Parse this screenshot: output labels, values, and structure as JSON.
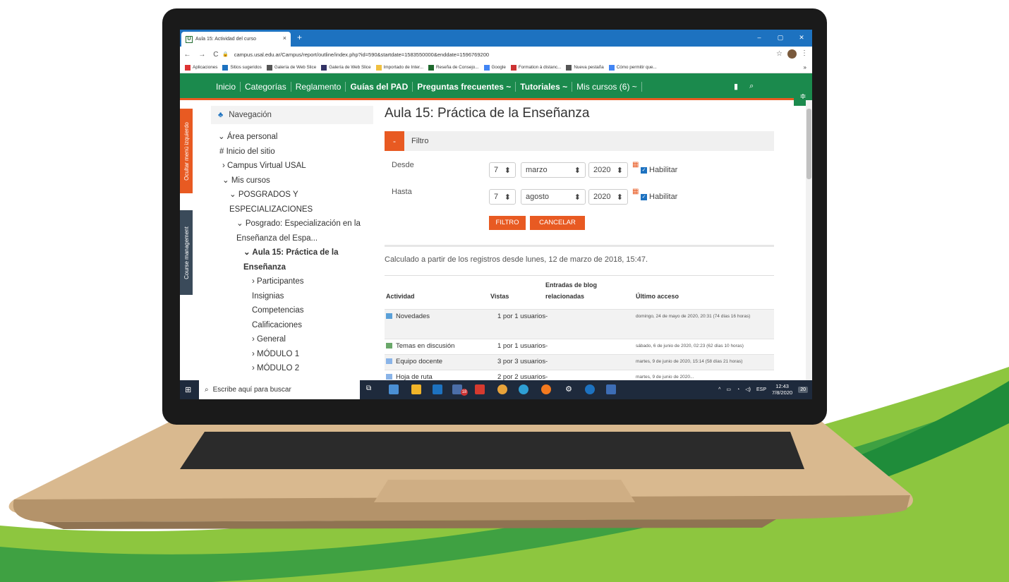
{
  "colors": {
    "site_green": "#1b8a4d",
    "accent_orange": "#e85a22",
    "browser_blue": "#1d72c0",
    "swoosh_light": "#8dc63f",
    "swoosh_dark": "#1f8c3a"
  },
  "browser": {
    "tab_title": "Aula 15: Actividad del curso",
    "tab_favicon": "U",
    "url": "campus.usal.edu.ar/Campus/report/outline/index.php?id=590&startdate=1583550000&enddate=1596769200",
    "bookmarks": [
      {
        "label": "Aplicaciones",
        "icon": "apps-icon"
      },
      {
        "label": "Sitios sugeridos",
        "icon": "bing-icon"
      },
      {
        "label": "Galería de Web Slice",
        "icon": "globe-icon"
      },
      {
        "label": "Galería de Web Slice",
        "icon": "slice-icon"
      },
      {
        "label": "Importado de Inter...",
        "icon": "folder-icon"
      },
      {
        "label": "Reseña de Consejo...",
        "icon": "usal-icon"
      },
      {
        "label": "Google",
        "icon": "google-icon"
      },
      {
        "label": "Formation à distanc...",
        "icon": "formation-icon"
      },
      {
        "label": "Nueva pestaña",
        "icon": "globe-icon"
      },
      {
        "label": "Cómo permitir que...",
        "icon": "google-icon"
      }
    ]
  },
  "site_nav": {
    "items": [
      "Inicio",
      "Categorías",
      "Reglamento",
      "Guías del PAD",
      "Preguntas frecuentes ~",
      "Tutoriales ~",
      "Mis cursos (6) ~"
    ]
  },
  "side_tabs": {
    "hide_menu": "Ocultar menú izquierdo",
    "course_mgmt": "Course management"
  },
  "sidebar": {
    "title": "Navegación",
    "tree": [
      "⌄ Área personal",
      "# Inicio del sitio",
      "› Campus Virtual USAL",
      "⌄ Mis cursos",
      "⌄ POSGRADOS Y",
      "ESPECIALIZACIONES",
      "⌄ Posgrado: Especialización en la",
      "Enseñanza del Espa...",
      "⌄ Aula 15: Práctica de la",
      "Enseñanza",
      "› Participantes",
      "Insignias",
      "Competencias",
      "Calificaciones",
      "› General",
      "› MÓDULO 1",
      "› MÓDULO 2"
    ]
  },
  "main": {
    "title": "Aula 15: Práctica de la Enseñanza",
    "filter_title": "Filtro",
    "desde_label": "Desde",
    "hasta_label": "Hasta",
    "desde": {
      "day": "7",
      "month": "marzo",
      "year": "2020"
    },
    "hasta": {
      "day": "7",
      "month": "agosto",
      "year": "2020"
    },
    "habilitar": "Habilitar",
    "filtro_btn": "FILTRO",
    "cancelar_btn": "CANCELAR",
    "computed_text": "Calculado a partir de los registros desde lunes, 12 de marzo de 2018, 15:47.",
    "columns": [
      "Actividad",
      "Vistas",
      "Entradas de blog relacionadas",
      "Último acceso"
    ],
    "rows": [
      {
        "activity": "Novedades",
        "views": "1 por 1 usuarios",
        "blog": "-",
        "last": "domingo, 24 de mayo de 2020, 20:31 (74 días 16 horas)"
      },
      {
        "activity": "Temas en discusión",
        "views": "1 por 1 usuarios",
        "blog": "-",
        "last": "sábado, 6 de junio de 2020, 02:23 (62 días 10 horas)"
      },
      {
        "activity": "Equipo docente",
        "views": "3 por 3 usuarios",
        "blog": "-",
        "last": "martes, 9 de junio de 2020, 15:14 (58 días 21 horas)"
      },
      {
        "activity": "Hoja de ruta",
        "views": "2 por 2 usuarios",
        "blog": "-",
        "last": "martes, 9 de junio de 2020..."
      }
    ]
  },
  "taskbar": {
    "search_placeholder": "Escribe aquí para buscar",
    "lang": "ESP",
    "time": "12:43",
    "date": "7/8/2020",
    "notifications": "20",
    "mail_badge": "18"
  }
}
